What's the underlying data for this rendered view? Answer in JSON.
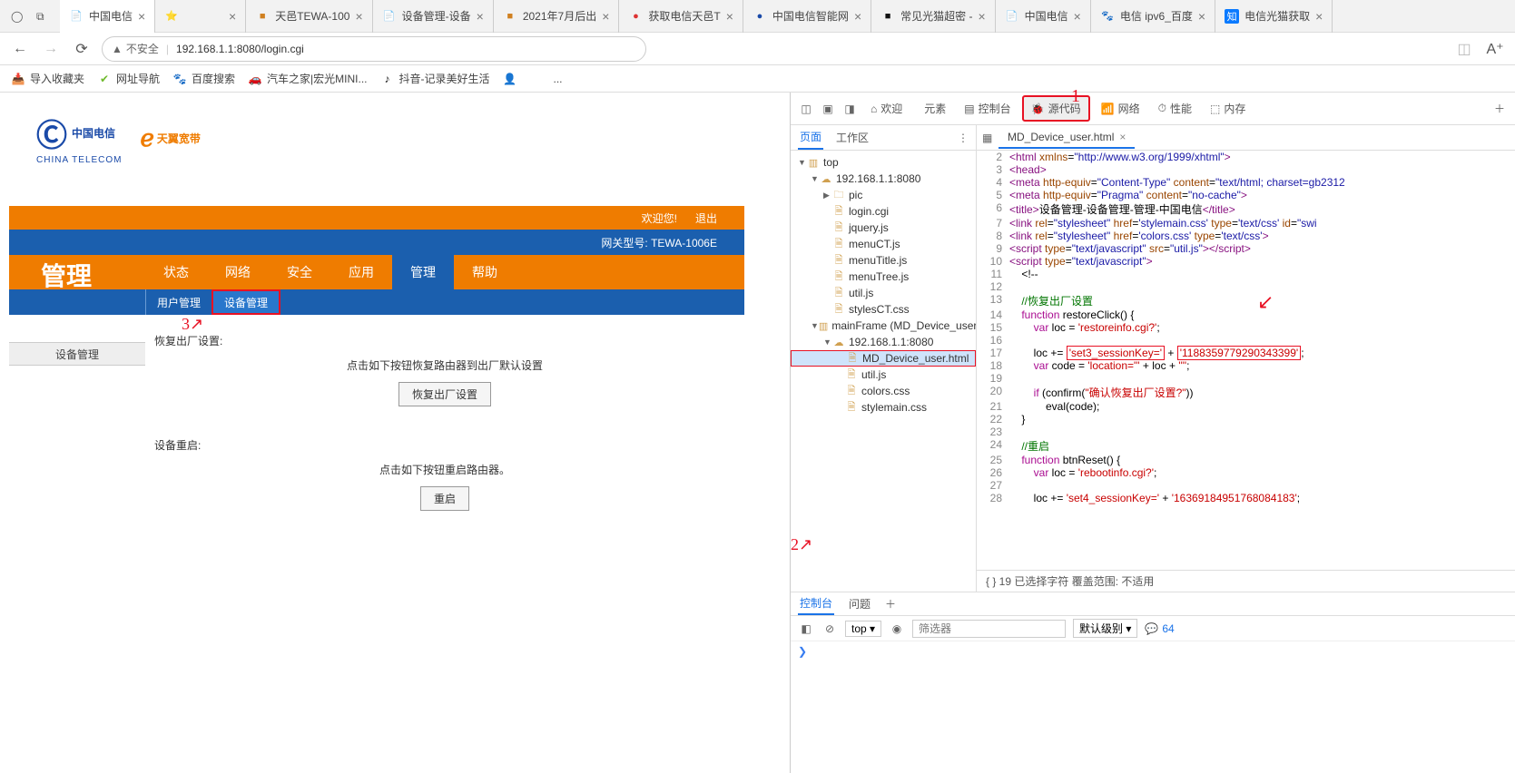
{
  "browser": {
    "tabs": [
      {
        "icon": "📄",
        "iconColor": "#888",
        "label": "中国电信",
        "active": true
      },
      {
        "icon": "⭐",
        "iconColor": "#f7b500",
        "label": ""
      },
      {
        "icon": "■",
        "iconColor": "#d08020",
        "label": "天邑TEWA-100"
      },
      {
        "icon": "📄",
        "iconColor": "#888",
        "label": "设备管理-设备"
      },
      {
        "icon": "■",
        "iconColor": "#d08020",
        "label": "2021年7月后出"
      },
      {
        "icon": "●",
        "iconColor": "#d33",
        "label": "获取电信天邑T"
      },
      {
        "icon": "●",
        "iconColor": "#1a4aa8",
        "label": "中国电信智能网"
      },
      {
        "icon": "■",
        "iconColor": "#111",
        "label": "常见光猫超密 -"
      },
      {
        "icon": "📄",
        "iconColor": "#888",
        "label": "中国电信"
      },
      {
        "icon": "🐾",
        "iconColor": "#2f7ae5",
        "label": "电信 ipv6_百度"
      },
      {
        "icon": "知",
        "iconColor": "#fff",
        "label": "电信光猫获取"
      }
    ],
    "insecure": "不安全",
    "url": "192.168.1.1:8080/login.cgi",
    "bookmarks": [
      {
        "icon": "📥",
        "label": "导入收藏夹"
      },
      {
        "icon": "✔",
        "iconColor": "#6fba2c",
        "label": "网址导航"
      },
      {
        "icon": "🐾",
        "iconColor": "#2f7ae5",
        "label": "百度搜索"
      },
      {
        "icon": "🚗",
        "iconColor": "#111",
        "label": "汽车之家|宏光MINI..."
      },
      {
        "icon": "♪",
        "iconColor": "#111",
        "label": "抖音-记录美好生活"
      },
      {
        "icon": "👤",
        "label": ""
      },
      {
        "icon": "",
        "label": "..."
      }
    ]
  },
  "router": {
    "brand_cn": "中国电信",
    "brand_en": "CHINA TELECOM",
    "brand2": "天翼宽带",
    "welcome": "欢迎您!",
    "logout": "退出",
    "gateway": "网关型号: TEWA-1006E",
    "page_title": "管理",
    "nav": [
      "状态",
      "网络",
      "安全",
      "应用",
      "管理",
      "帮助"
    ],
    "nav_active": 4,
    "subnav": [
      "用户管理",
      "设备管理"
    ],
    "subnav_active": 1,
    "side_selected": "设备管理",
    "restore_title": "恢复出厂设置:",
    "restore_desc": "点击如下按钮恢复路由器到出厂默认设置",
    "restore_btn": "恢复出厂设置",
    "reboot_title": "设备重启:",
    "reboot_desc": "点击如下按钮重启路由器。",
    "reboot_btn": "重启"
  },
  "devtools": {
    "top_tabs": [
      "欢迎",
      "元素",
      "控制台",
      "源代码",
      "网络",
      "性能",
      "内存"
    ],
    "top_active": 3,
    "side_tabs": [
      "页面",
      "工作区"
    ],
    "side_active": 0,
    "tree": [
      {
        "indent": 0,
        "arrow": "▼",
        "icon": "▥",
        "label": "top"
      },
      {
        "indent": 1,
        "arrow": "▼",
        "icon": "☁",
        "label": "192.168.1.1:8080"
      },
      {
        "indent": 2,
        "arrow": "▶",
        "icon": "🗀",
        "label": "pic"
      },
      {
        "indent": 2,
        "arrow": "",
        "icon": "🗎",
        "label": "login.cgi"
      },
      {
        "indent": 2,
        "arrow": "",
        "icon": "🗎",
        "label": "jquery.js"
      },
      {
        "indent": 2,
        "arrow": "",
        "icon": "🗎",
        "label": "menuCT.js"
      },
      {
        "indent": 2,
        "arrow": "",
        "icon": "🗎",
        "label": "menuTitle.js"
      },
      {
        "indent": 2,
        "arrow": "",
        "icon": "🗎",
        "label": "menuTree.js"
      },
      {
        "indent": 2,
        "arrow": "",
        "icon": "🗎",
        "label": "util.js"
      },
      {
        "indent": 2,
        "arrow": "",
        "icon": "🗎",
        "label": "stylesCT.css"
      },
      {
        "indent": 1,
        "arrow": "▼",
        "icon": "▥",
        "label": "mainFrame (MD_Device_user.ht"
      },
      {
        "indent": 2,
        "arrow": "▼",
        "icon": "☁",
        "label": "192.168.1.1:8080"
      },
      {
        "indent": 3,
        "arrow": "",
        "icon": "🗎",
        "label": "MD_Device_user.html",
        "selected": true,
        "hl": true
      },
      {
        "indent": 3,
        "arrow": "",
        "icon": "🗎",
        "label": "util.js"
      },
      {
        "indent": 3,
        "arrow": "",
        "icon": "🗎",
        "label": "colors.css"
      },
      {
        "indent": 3,
        "arrow": "",
        "icon": "🗎",
        "label": "stylemain.css"
      }
    ],
    "code_tab": "MD_Device_user.html",
    "status": "{ }   19 已选择字符   覆盖范围: 不适用",
    "console_tabs": [
      "控制台",
      "问题"
    ],
    "console_active": 0,
    "filter_top": "top",
    "filter_placeholder": "筛选器",
    "filter_level": "默认级别",
    "msg_count": "64",
    "prompt": "❯"
  },
  "annot": {
    "a1": "1",
    "a2": "↙"
  }
}
